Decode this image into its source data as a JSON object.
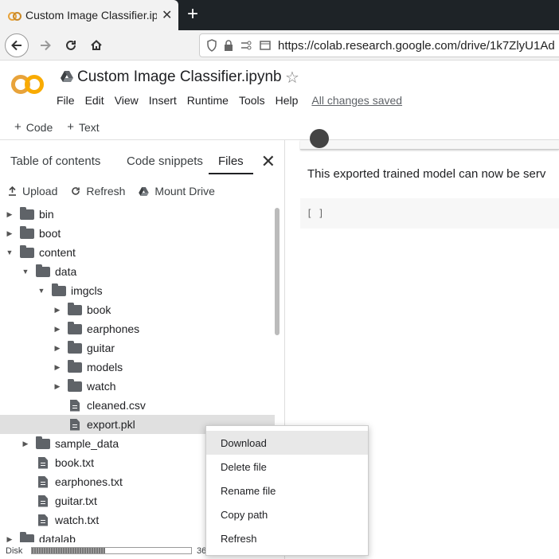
{
  "browser": {
    "tab_title": "Custom Image Classifier.ipynb - Colaboratory",
    "tab_close": "✕",
    "new_tab": "+",
    "url": "https://colab.research.google.com/drive/1k7ZlyU1Ad"
  },
  "colab": {
    "notebook_title": "Custom Image Classifier.ipynb",
    "menu": [
      "File",
      "Edit",
      "View",
      "Insert",
      "Runtime",
      "Tools",
      "Help"
    ],
    "save_status": "All changes saved",
    "toolbar": {
      "code_label": "Code",
      "text_label": "Text"
    }
  },
  "sidebar": {
    "tabs": [
      "Table of contents",
      "Code snippets",
      "Files"
    ],
    "active_tab": "Files",
    "actions": {
      "upload": "Upload",
      "refresh": "Refresh",
      "mount": "Mount Drive"
    },
    "tree": [
      {
        "name": "bin",
        "type": "folder",
        "depth": 0,
        "expanded": false
      },
      {
        "name": "boot",
        "type": "folder",
        "depth": 0,
        "expanded": false
      },
      {
        "name": "content",
        "type": "folder",
        "depth": 0,
        "expanded": true
      },
      {
        "name": "data",
        "type": "folder",
        "depth": 1,
        "expanded": true
      },
      {
        "name": "imgcls",
        "type": "folder",
        "depth": 2,
        "expanded": true
      },
      {
        "name": "book",
        "type": "folder",
        "depth": 3,
        "expanded": false
      },
      {
        "name": "earphones",
        "type": "folder",
        "depth": 3,
        "expanded": false
      },
      {
        "name": "guitar",
        "type": "folder",
        "depth": 3,
        "expanded": false
      },
      {
        "name": "models",
        "type": "folder",
        "depth": 3,
        "expanded": false
      },
      {
        "name": "watch",
        "type": "folder",
        "depth": 3,
        "expanded": false
      },
      {
        "name": "cleaned.csv",
        "type": "file",
        "depth": 3
      },
      {
        "name": "export.pkl",
        "type": "file",
        "depth": 3,
        "selected": true
      },
      {
        "name": "sample_data",
        "type": "folder",
        "depth": 1,
        "expanded": false
      },
      {
        "name": "book.txt",
        "type": "file",
        "depth": 1
      },
      {
        "name": "earphones.txt",
        "type": "file",
        "depth": 1
      },
      {
        "name": "guitar.txt",
        "type": "file",
        "depth": 1
      },
      {
        "name": "watch.txt",
        "type": "file",
        "depth": 1
      },
      {
        "name": "datalab",
        "type": "folder",
        "depth": 0,
        "expanded": false
      }
    ],
    "disk": {
      "label": "Disk",
      "used_fraction": 0.46,
      "value_text": "36"
    }
  },
  "notebook": {
    "markdown_text": "This exported trained model can now be serv",
    "code_cell_prompt": "[ ]"
  },
  "context_menu": {
    "items": [
      "Download",
      "Delete file",
      "Rename file",
      "Copy path",
      "Refresh"
    ],
    "hovered": "Download"
  }
}
